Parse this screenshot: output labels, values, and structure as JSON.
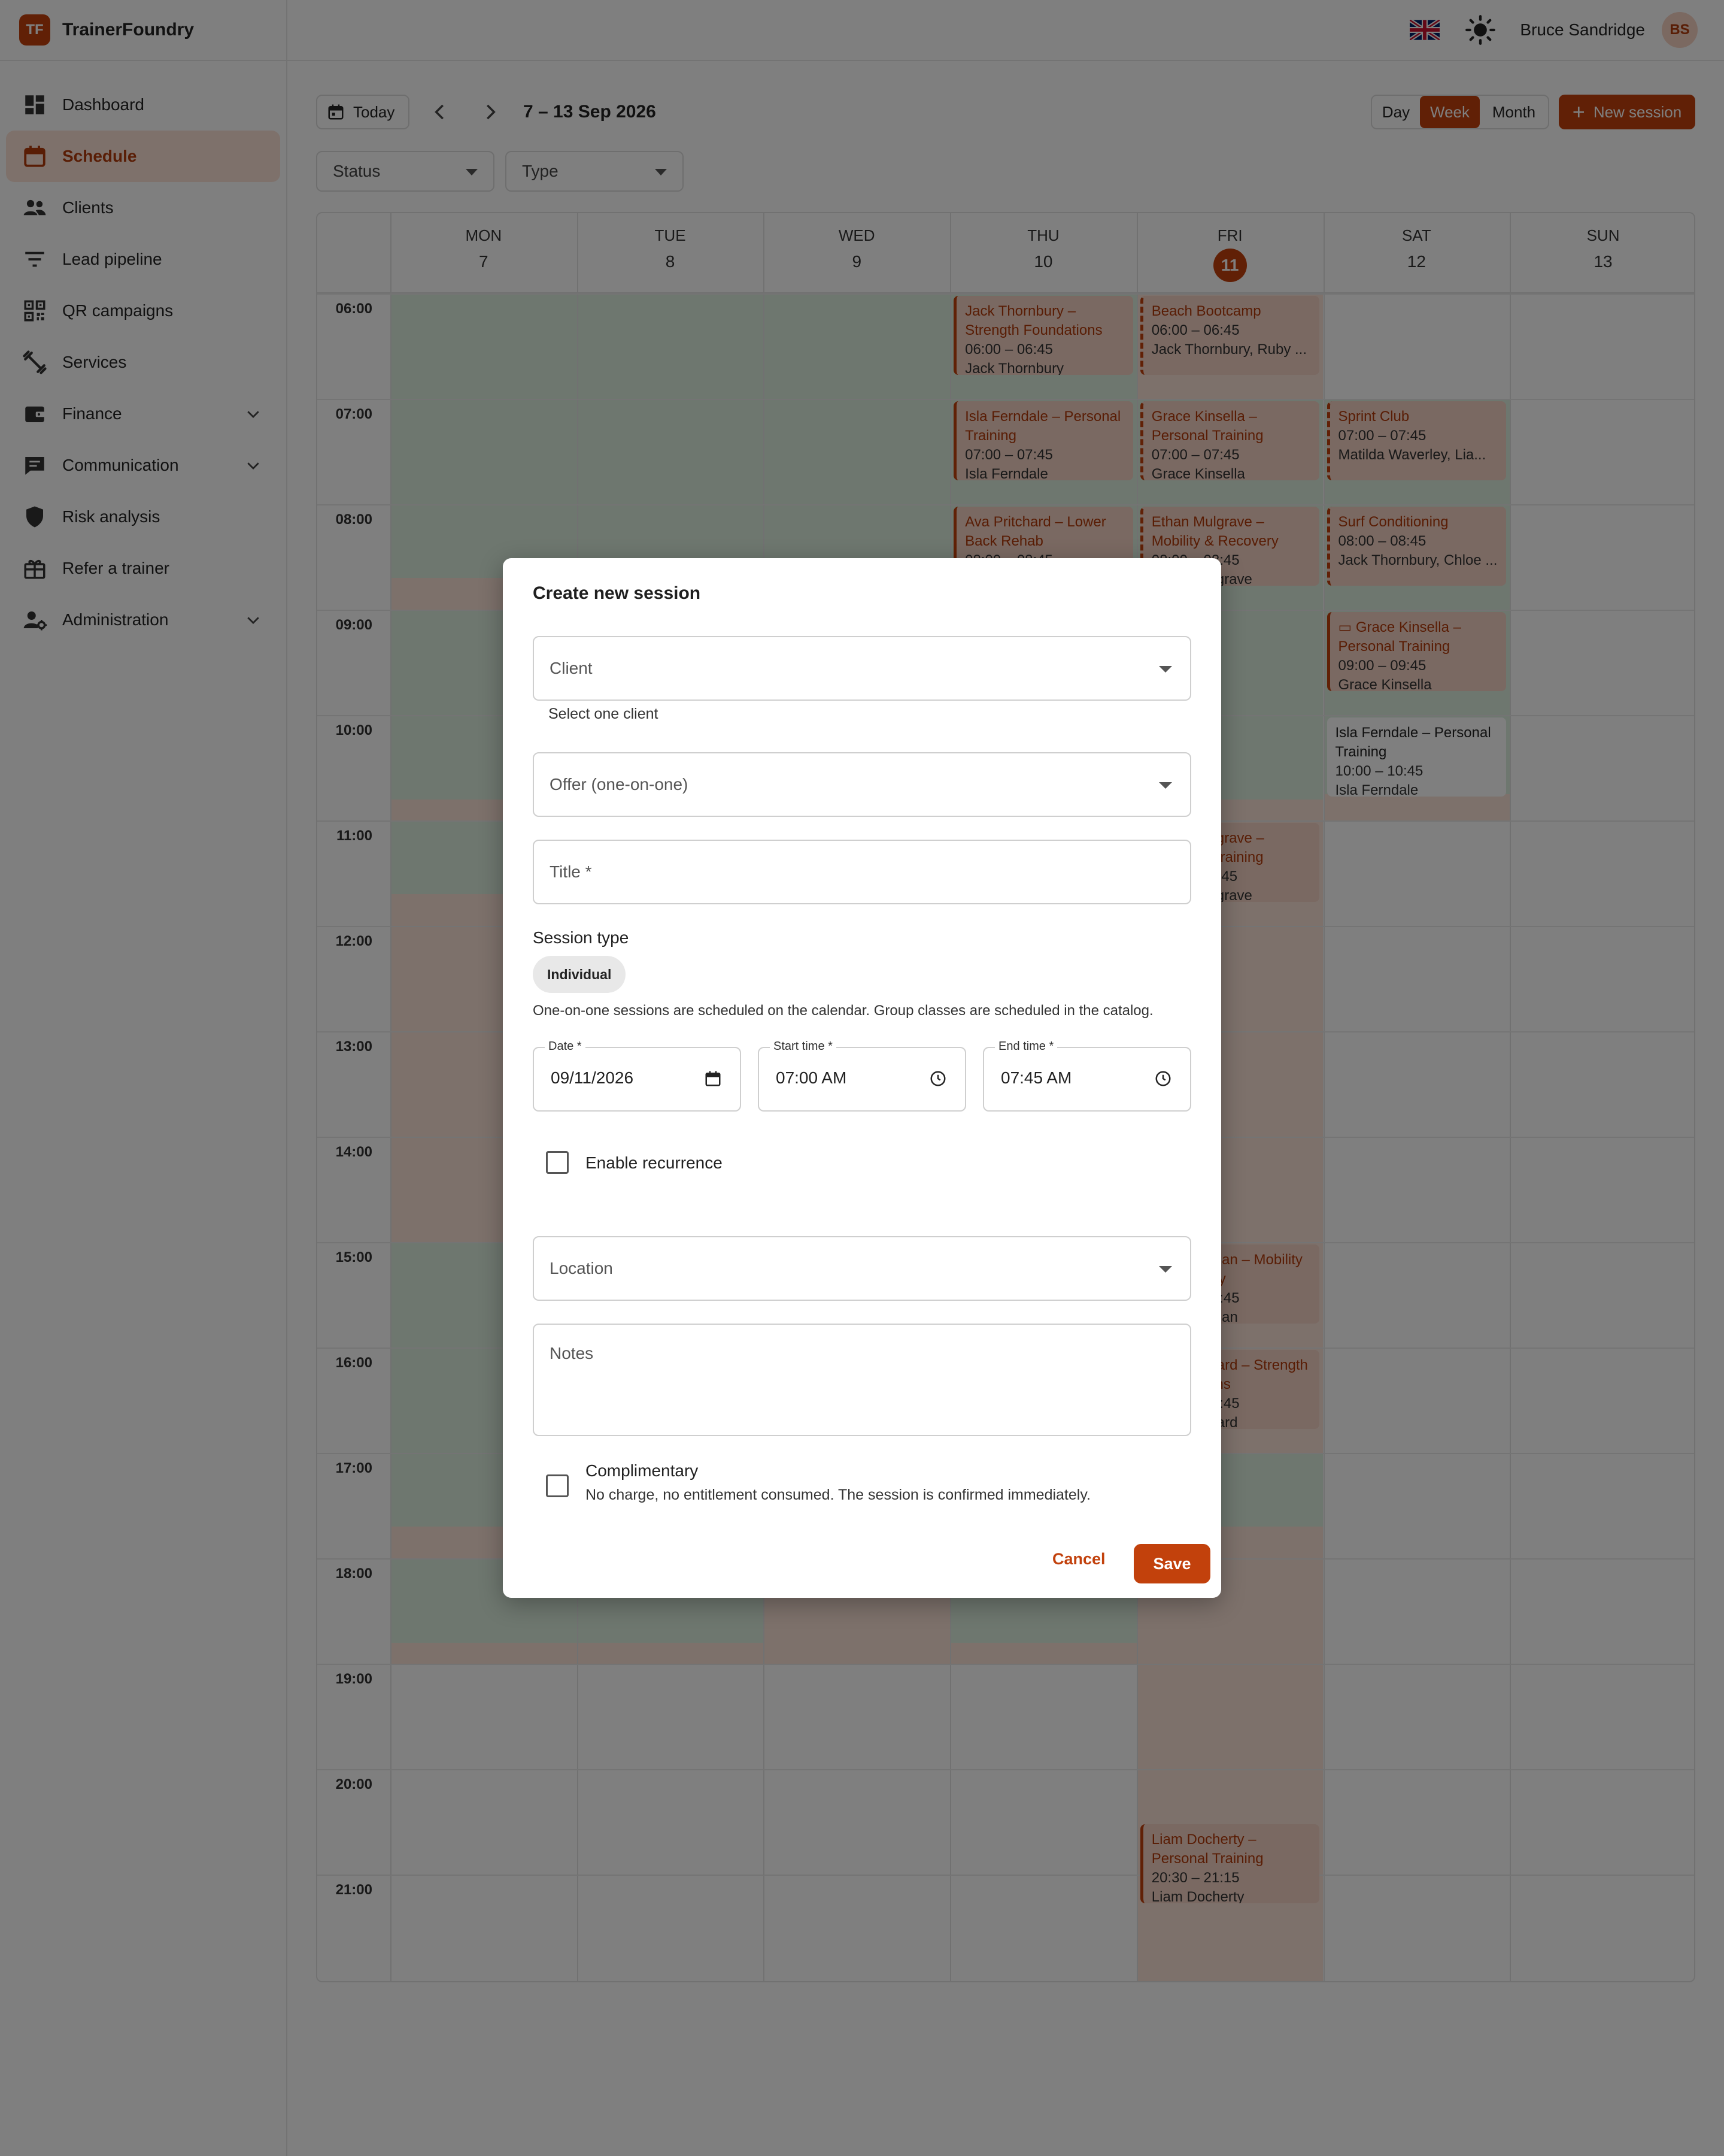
{
  "brand": {
    "logo_text": "TF",
    "name": "TrainerFoundry"
  },
  "sidebar": {
    "items": [
      {
        "label": "Dashboard",
        "icon": "dashboard-icon",
        "active": false,
        "expandable": false
      },
      {
        "label": "Schedule",
        "icon": "calendar-icon",
        "active": true,
        "expandable": false
      },
      {
        "label": "Clients",
        "icon": "people-icon",
        "active": false,
        "expandable": false
      },
      {
        "label": "Lead pipeline",
        "icon": "filter-lines-icon",
        "active": false,
        "expandable": false
      },
      {
        "label": "QR campaigns",
        "icon": "qr-code-icon",
        "active": false,
        "expandable": false
      },
      {
        "label": "Services",
        "icon": "dumbbell-icon",
        "active": false,
        "expandable": false
      },
      {
        "label": "Finance",
        "icon": "wallet-icon",
        "active": false,
        "expandable": true
      },
      {
        "label": "Communication",
        "icon": "chat-icon",
        "active": false,
        "expandable": true
      },
      {
        "label": "Risk analysis",
        "icon": "shield-icon",
        "active": false,
        "expandable": false
      },
      {
        "label": "Refer a trainer",
        "icon": "gift-icon",
        "active": false,
        "expandable": false
      },
      {
        "label": "Administration",
        "icon": "user-gear-icon",
        "active": false,
        "expandable": true
      }
    ]
  },
  "header": {
    "user_name": "Bruce Sandridge",
    "avatar_initials": "BS",
    "language_flag": "uk-flag-icon",
    "theme_icon": "sun-icon"
  },
  "toolbar": {
    "today_label": "Today",
    "range_label": "7 – 13 Sep 2026",
    "views": [
      "Day",
      "Week",
      "Month"
    ],
    "active_view": "Week",
    "new_session_label": "New session",
    "filters": [
      {
        "label": "Status"
      },
      {
        "label": "Type"
      }
    ]
  },
  "calendar": {
    "days": [
      {
        "dow": "MON",
        "num": "7",
        "today": false
      },
      {
        "dow": "TUE",
        "num": "8",
        "today": false
      },
      {
        "dow": "WED",
        "num": "9",
        "today": false
      },
      {
        "dow": "THU",
        "num": "10",
        "today": false
      },
      {
        "dow": "FRI",
        "num": "11",
        "today": true
      },
      {
        "dow": "SAT",
        "num": "12",
        "today": false
      },
      {
        "dow": "SUN",
        "num": "13",
        "today": false
      }
    ],
    "hours": [
      "06:00",
      "07:00",
      "08:00",
      "09:00",
      "10:00",
      "11:00",
      "12:00",
      "13:00",
      "14:00",
      "15:00",
      "16:00",
      "17:00",
      "18:00",
      "19:00",
      "20:00",
      "21:00"
    ],
    "events": [
      {
        "day": 3,
        "start": "06:00",
        "end": "06:45",
        "title": "Jack Thornbury – Strength Foundations",
        "time": "06:00 – 06:45",
        "who": "Jack Thornbury",
        "style": "confirmed"
      },
      {
        "day": 4,
        "start": "06:00",
        "end": "06:45",
        "title": "Beach Bootcamp",
        "time": "06:00 – 06:45",
        "who": "Jack Thornbury, Ruby ...",
        "style": "pending"
      },
      {
        "day": 3,
        "start": "07:00",
        "end": "07:45",
        "title": "Isla Ferndale – Personal Training",
        "time": "07:00 – 07:45",
        "who": "Isla Ferndale",
        "style": "confirmed"
      },
      {
        "day": 4,
        "start": "07:00",
        "end": "07:45",
        "title": "Grace Kinsella – Personal Training",
        "time": "07:00 – 07:45",
        "who": "Grace Kinsella",
        "style": "pending"
      },
      {
        "day": 5,
        "start": "07:00",
        "end": "07:45",
        "title": "Sprint Club",
        "time": "07:00 – 07:45",
        "who": "Matilda Waverley, Lia...",
        "style": "pending"
      },
      {
        "day": 3,
        "start": "08:00",
        "end": "08:45",
        "title": "Ava Pritchard – Lower Back Rehab",
        "time": "08:00 – 08:45",
        "who": "Ava Pritchard",
        "style": "confirmed"
      },
      {
        "day": 4,
        "start": "08:00",
        "end": "08:45",
        "title": "Ethan Mulgrave – Mobility & Recovery",
        "time": "08:00 – 08:45",
        "who": "Ethan Mulgrave",
        "style": "pending"
      },
      {
        "day": 5,
        "start": "08:00",
        "end": "08:45",
        "title": "Surf Conditioning",
        "time": "08:00 – 08:45",
        "who": "Jack Thornbury, Chloe ...",
        "style": "pending"
      },
      {
        "day": 5,
        "start": "09:00",
        "end": "09:45",
        "title": "▭ Grace Kinsella – Personal Training",
        "time": "09:00 – 09:45",
        "who": "Grace Kinsella",
        "style": "confirmed"
      },
      {
        "day": 5,
        "start": "10:00",
        "end": "10:45",
        "title": "Isla Ferndale – Personal Training",
        "time": "10:00 – 10:45",
        "who": "Isla Ferndale",
        "style": "plain"
      },
      {
        "day": 4,
        "start": "11:00",
        "end": "11:45",
        "title": "Ethan Mulgrave – Personal Training",
        "time": "11:00 – 11:45",
        "who": "Ethan Mulgrave",
        "style": "confirmed"
      },
      {
        "day": 4,
        "start": "15:00",
        "end": "15:45",
        "title": "Finn Hartigan – Mobility & Recovery",
        "time": "15:00 – 15:45",
        "who": "Finn Hartigan",
        "style": "confirmed"
      },
      {
        "day": 4,
        "start": "16:00",
        "end": "16:45",
        "title": "Ava Pritchard – Strength Foundations",
        "time": "16:00 – 16:45",
        "who": "Ava Pritchard",
        "style": "confirmed"
      },
      {
        "day": 4,
        "start": "20:30",
        "end": "21:15",
        "title": "Liam Docherty – Personal Training",
        "time": "20:30 – 21:15",
        "who": "Liam Docherty",
        "style": "confirmed"
      }
    ]
  },
  "dialog": {
    "title": "Create new session",
    "client_placeholder": "Client",
    "client_helper": "Select one client",
    "offer_placeholder": "Offer (one-on-one)",
    "title_placeholder": "Title *",
    "session_type_label": "Session type",
    "session_type_chip": "Individual",
    "session_type_note": "One-on-one sessions are scheduled on the calendar. Group classes are scheduled in the catalog.",
    "date_label": "Date *",
    "date_value": "09/11/2026",
    "start_label": "Start time *",
    "start_value": "07:00  AM",
    "end_label": "End time *",
    "end_value": "07:45  AM",
    "recurrence_label": "Enable recurrence",
    "location_placeholder": "Location",
    "notes_placeholder": "Notes",
    "complimentary_label": "Complimentary",
    "complimentary_sub": "No charge, no entitlement consumed. The session is confirmed immediately.",
    "cancel_label": "Cancel",
    "save_label": "Save"
  },
  "colors": {
    "accent": "#c2410c",
    "available": "#dcefdf",
    "unavailable": "#fbe2d6"
  }
}
